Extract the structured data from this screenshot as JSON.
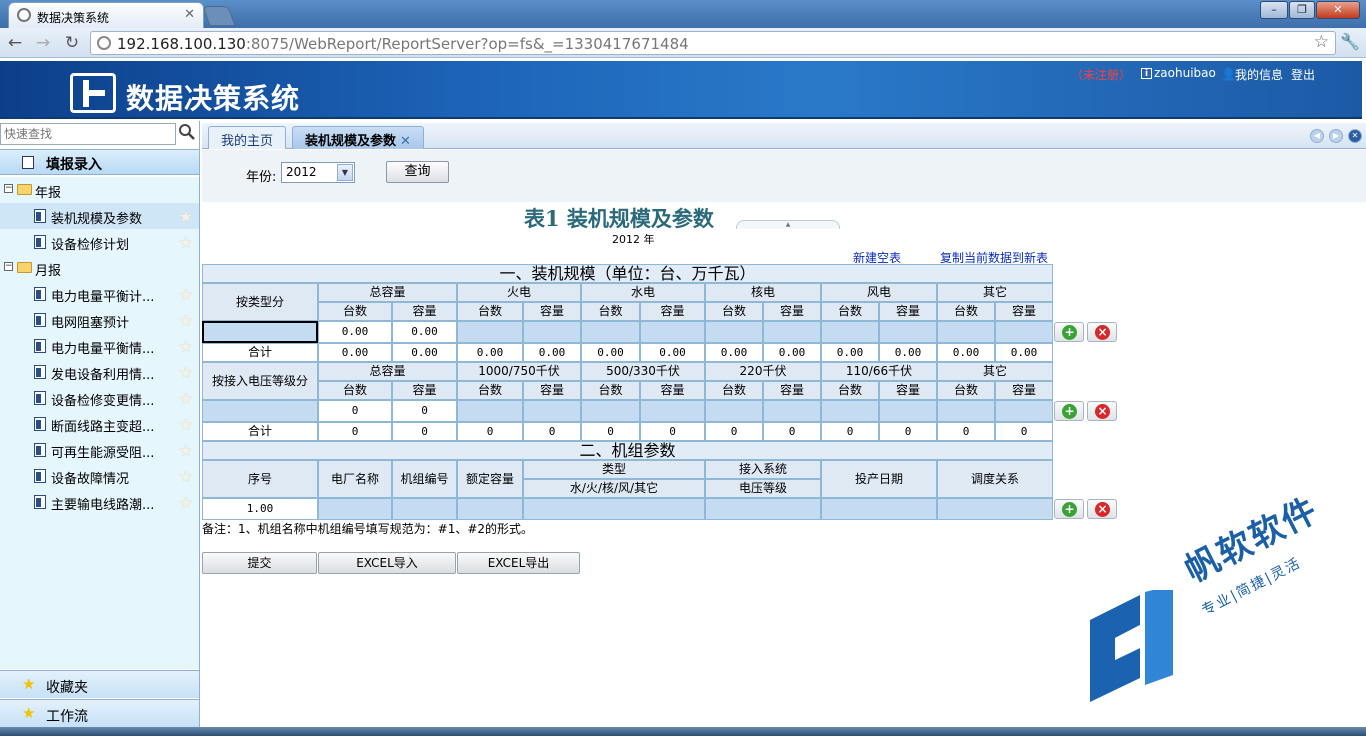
{
  "browser": {
    "tab_title": "数据决策系统",
    "url_host": "192.168.100.130",
    "url_rest": ":8075/WebReport/ReportServer?op=fs&_=1330417671484"
  },
  "header": {
    "app_title": "数据决策系统",
    "unregistered": "（未注册）",
    "username": "zaohuibao",
    "my_info": "我的信息",
    "logout": "登出"
  },
  "sidebar": {
    "search_placeholder": "快速查找",
    "section_title": "填报录入",
    "tree": [
      {
        "label": "年报",
        "type": "folder"
      },
      {
        "label": "装机规模及参数",
        "type": "doc"
      },
      {
        "label": "设备检修计划",
        "type": "doc"
      },
      {
        "label": "月报",
        "type": "folder"
      },
      {
        "label": "电力电量平衡计...",
        "type": "doc"
      },
      {
        "label": "电网阻塞预计",
        "type": "doc"
      },
      {
        "label": "电力电量平衡情...",
        "type": "doc"
      },
      {
        "label": "发电设备利用情...",
        "type": "doc"
      },
      {
        "label": "设备检修变更情...",
        "type": "doc"
      },
      {
        "label": "断面线路主变超...",
        "type": "doc"
      },
      {
        "label": "可再生能源受阻...",
        "type": "doc"
      },
      {
        "label": "设备故障情况",
        "type": "doc"
      },
      {
        "label": "主要输电线路潮...",
        "type": "doc"
      }
    ],
    "favorites": "收藏夹",
    "workflow": "工作流"
  },
  "tabs": [
    {
      "label": "我的主页"
    },
    {
      "label": "装机规模及参数"
    }
  ],
  "form": {
    "year_label": "年份:",
    "year_value": "2012",
    "query_button": "查询"
  },
  "report": {
    "title": "表1  装机规模及参数",
    "year_text": "2012 年",
    "new_table_link": "新建空表",
    "copy_link": "复制当前数据到新表",
    "section1_title": "一、装机规模（单位：台、万千瓦）",
    "section2_title": "二、机组参数",
    "by_type": "按类型分",
    "by_voltage": "按接入电压等级分",
    "type_groups": [
      "总容量",
      "火电",
      "水电",
      "核电",
      "风电",
      "其它"
    ],
    "voltage_groups": [
      "总容量",
      "1000/750千伏",
      "500/330千伏",
      "220千伏",
      "110/66千伏",
      "其它"
    ],
    "sub_count": "台数",
    "sub_capacity": "容量",
    "total_label": "合计",
    "type_input_row": [
      "0.00",
      "0.00"
    ],
    "type_total_row": [
      "0.00",
      "0.00",
      "0.00",
      "0.00",
      "0.00",
      "0.00",
      "0.00",
      "0.00",
      "0.00",
      "0.00",
      "0.00",
      "0.00"
    ],
    "voltage_input_row": [
      "0",
      "0"
    ],
    "voltage_total_row": [
      "0",
      "0",
      "0",
      "0",
      "0",
      "0",
      "0",
      "0",
      "0",
      "0",
      "0",
      "0"
    ],
    "unit_headers": {
      "seq": "序号",
      "plant": "电厂名称",
      "unit_no": "机组编号",
      "rated": "额定容量",
      "type_top": "类型",
      "type_bottom": "水/火/核/风/其它",
      "access_top": "接入系统",
      "access_bottom": "电压等级",
      "commission": "投产日期",
      "dispatch": "调度关系"
    },
    "unit_row_seq": "1.00",
    "note": "备注：1、机组名称中机组编号填写规范为：#1、#2的形式。",
    "buttons": {
      "submit": "提交",
      "excel_import": "EXCEL导入",
      "excel_export": "EXCEL导出"
    }
  },
  "watermark": {
    "name": "帆软软件",
    "slogan": "专业|简捷|灵活"
  }
}
